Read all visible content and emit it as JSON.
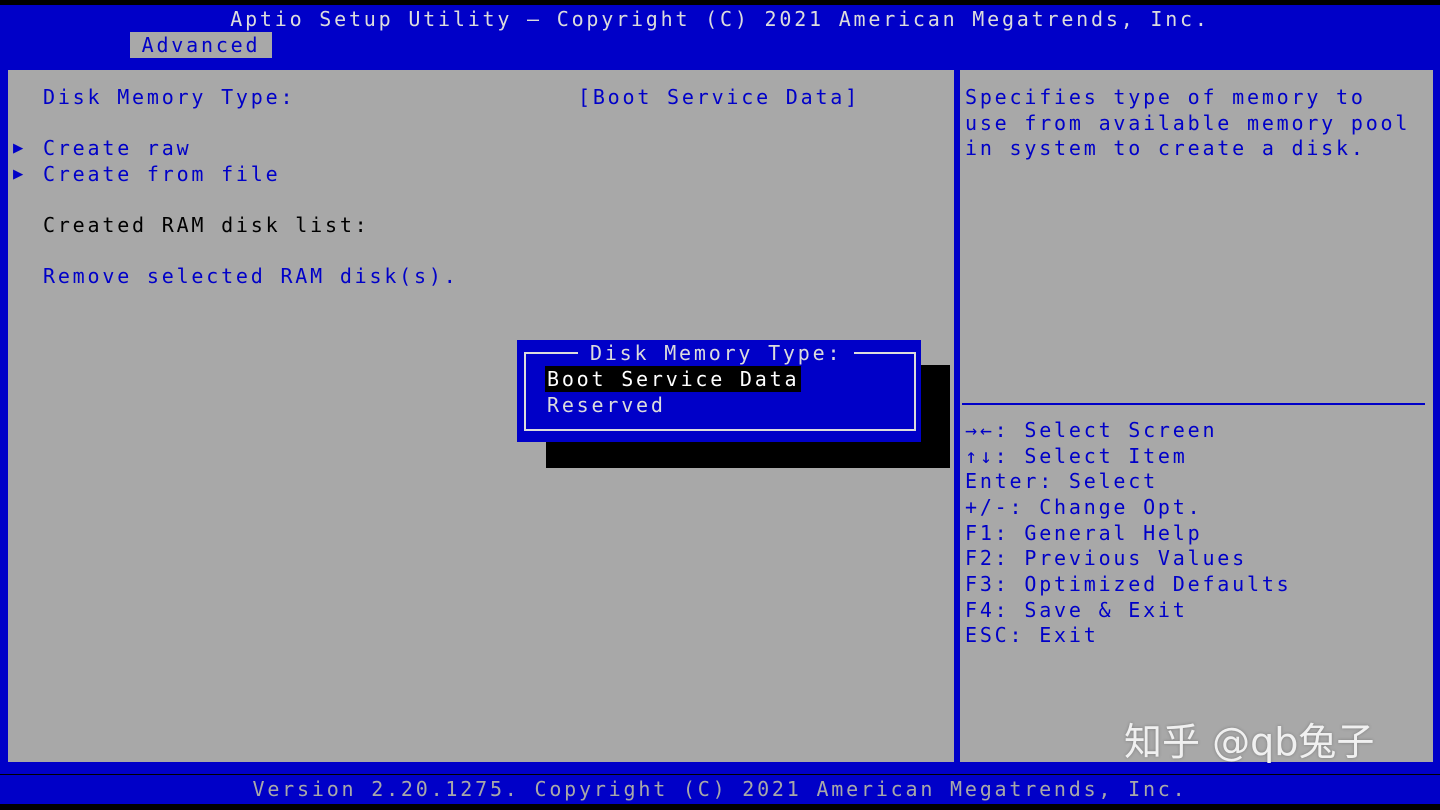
{
  "header": {
    "title": "Aptio Setup Utility – Copyright (C) 2021 American Megatrends, Inc.",
    "tab": "Advanced"
  },
  "settings": {
    "disk_memory_type_label": "Disk Memory Type:",
    "disk_memory_type_value": "[Boot Service Data]",
    "create_raw": "Create raw",
    "create_from_file": "Create from file",
    "created_list_label": "Created RAM disk list:",
    "remove_selected": "Remove selected RAM disk(s)."
  },
  "help": {
    "lines": [
      "Specifies type of memory to",
      "use from available memory pool",
      "in system to create a disk."
    ]
  },
  "keys": [
    "→←: Select Screen",
    "↑↓: Select Item",
    "Enter: Select",
    "+/-: Change Opt.",
    "F1: General Help",
    "F2: Previous Values",
    "F3: Optimized Defaults",
    "F4: Save & Exit",
    "ESC: Exit"
  ],
  "popup": {
    "title": "Disk Memory Type:",
    "options": [
      "Boot Service Data",
      "Reserved"
    ],
    "selected": "Boot Service Data"
  },
  "footer": {
    "version": "Version 2.20.1275. Copyright (C) 2021 American Megatrends, Inc."
  },
  "watermark": "知乎 @qb兔子",
  "icons": {
    "submenu": "triangle-right-icon"
  },
  "colors": {
    "bios_blue": "#0000c8",
    "panel_gray": "#a8a8a8",
    "highlight_black": "#000000"
  }
}
